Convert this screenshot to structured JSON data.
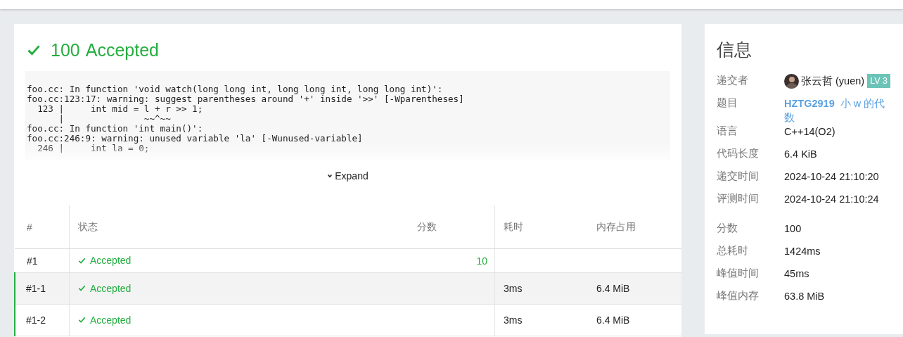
{
  "result": {
    "score": "100",
    "status": "Accepted",
    "accepted": true
  },
  "compile_log": [
    "foo.cc: In function 'void watch(long long int, long long int, long long int)':",
    "foo.cc:123:17: warning: suggest parentheses around '+' inside '>>' [-Wparentheses]",
    "  123 |     int mid = l + r >> 1;",
    "      |               ~~^~~",
    "foo.cc: In function 'int main()':",
    "foo.cc:246:9: warning: unused variable 'la' [-Wunused-variable]",
    "  246 |     int la = 0;"
  ],
  "expand_label": "Expand",
  "table": {
    "columns": [
      "#",
      "状态",
      "分数",
      "耗时",
      "内存占用"
    ],
    "rows": [
      {
        "id": "#1",
        "status": "Accepted",
        "accepted": true,
        "score": "10",
        "children": [
          {
            "id": "#1-1",
            "status": "Accepted",
            "accepted": true,
            "time": "3ms",
            "memory": "6.4 MiB"
          },
          {
            "id": "#1-2",
            "status": "Accepted",
            "accepted": true,
            "time": "3ms",
            "memory": "6.4 MiB"
          }
        ]
      }
    ]
  },
  "info": {
    "title": "信息",
    "groups": [
      [
        {
          "kind": "user",
          "label": "递交者",
          "name": "张云哲 (yuen)",
          "badge": "LV 3"
        },
        {
          "kind": "problem",
          "label": "题目",
          "id": "HZTG2919",
          "name": "小 w 的代数"
        },
        {
          "kind": "text",
          "label": "语言",
          "value": "C++14(O2)"
        },
        {
          "kind": "text",
          "label": "代码长度",
          "value": "6.4 KiB"
        },
        {
          "kind": "text",
          "label": "递交时间",
          "value": "2024-10-24 21:10:20"
        },
        {
          "kind": "text",
          "label": "评测时间",
          "value": "2024-10-24 21:10:24"
        }
      ],
      [
        {
          "kind": "text",
          "label": "分数",
          "value": "100"
        },
        {
          "kind": "text",
          "label": "总耗时",
          "value": "1424ms"
        },
        {
          "kind": "text",
          "label": "峰值时间",
          "value": "45ms"
        },
        {
          "kind": "text",
          "label": "峰值内存",
          "value": "63.8 MiB"
        }
      ]
    ]
  }
}
